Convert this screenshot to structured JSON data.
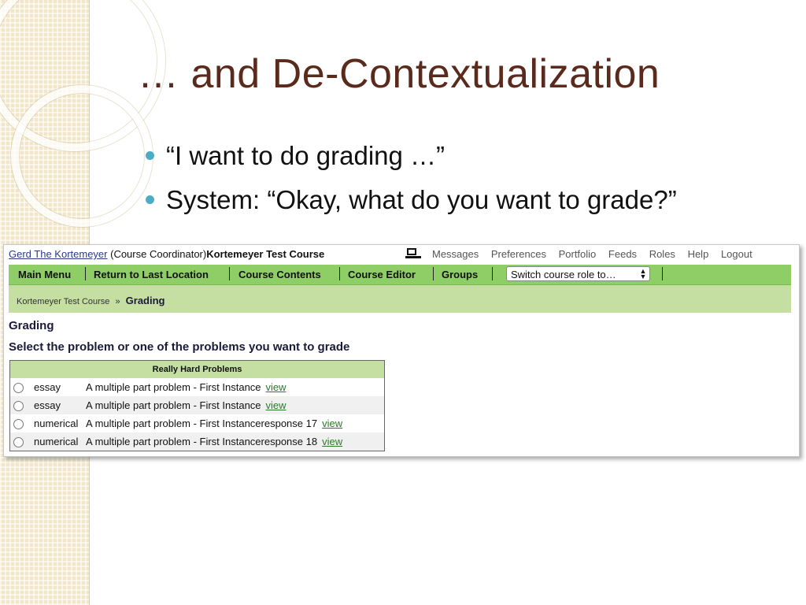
{
  "slide": {
    "title": "… and De-Contextualization",
    "bullets": [
      "“I want to do grading …”",
      "System: “Okay, what do you want to grade?”"
    ],
    "bullet_color": "#4bacc6",
    "title_color": "#5a2b1c"
  },
  "screenshot": {
    "user_name": "Gerd The Kortemeyer",
    "user_role": "(Course Coordinator)",
    "course_name": "Kortemeyer Test Course",
    "top_nav": [
      "Messages",
      "Preferences",
      "Portfolio",
      "Feeds",
      "Roles",
      "Help",
      "Logout"
    ],
    "menu": {
      "items": [
        "Main Menu",
        "Return to Last Location",
        "Course Contents",
        "Course Editor",
        "Groups"
      ],
      "role_select": "Switch course role to…"
    },
    "breadcrumb": {
      "parent": "Kortemeyer Test Course",
      "separator": "»",
      "current": "Grading"
    },
    "heading": "Grading",
    "instruction": "Select the problem or one of the problems you want to grade",
    "table": {
      "header": "Really Hard Problems",
      "rows": [
        {
          "type": "essay",
          "title": "A multiple part problem - First Instance",
          "link": "view"
        },
        {
          "type": "essay",
          "title": "A multiple part problem - First Instance",
          "link": "view"
        },
        {
          "type": "numerical",
          "title": "A multiple part problem - First Instanceresponse 17",
          "link": "view"
        },
        {
          "type": "numerical",
          "title": "A multiple part problem - First Instanceresponse 18",
          "link": "view"
        }
      ]
    },
    "colors": {
      "menu_bar": "#8fce66",
      "breadcrumb_bar": "#c4dfa1",
      "link": "#2a7a2a"
    }
  }
}
